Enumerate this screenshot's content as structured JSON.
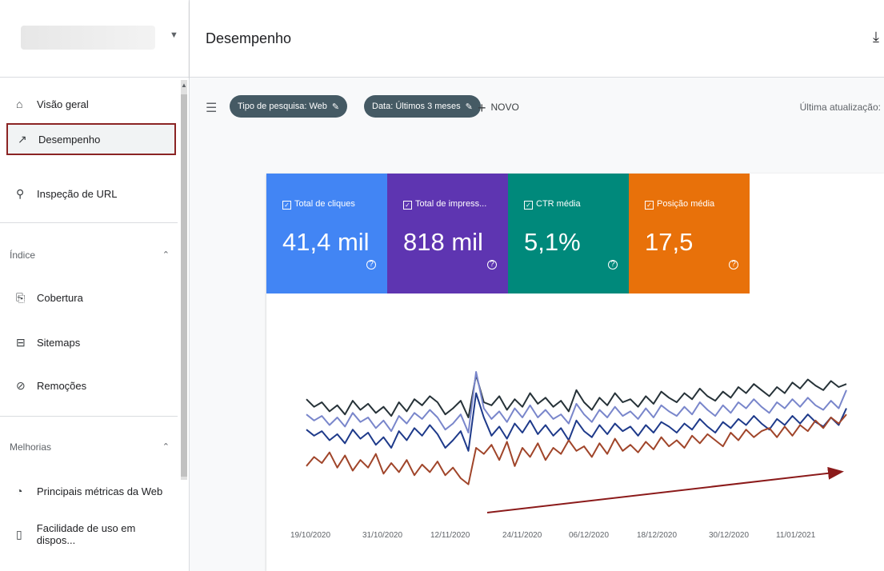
{
  "header": {
    "title": "Desempenho"
  },
  "sidebar": {
    "items": [
      {
        "label": "Visão geral",
        "icon": "home-icon"
      },
      {
        "label": "Desempenho",
        "icon": "trend-icon"
      },
      {
        "label": "Inspeção de URL",
        "icon": "search-icon"
      }
    ],
    "sections": [
      {
        "title": "Índice",
        "items": [
          {
            "label": "Cobertura",
            "icon": "coverage-icon"
          },
          {
            "label": "Sitemaps",
            "icon": "sitemap-icon"
          },
          {
            "label": "Remoções",
            "icon": "removal-icon"
          }
        ]
      },
      {
        "title": "Melhorias",
        "items": [
          {
            "label": "Principais métricas da Web",
            "icon": "gauge-icon"
          },
          {
            "label": "Facilidade de uso em dispos...",
            "icon": "mobile-icon"
          }
        ]
      }
    ]
  },
  "filters": {
    "chips": [
      "Tipo de pesquisa: Web",
      "Data: Últimos 3 meses"
    ],
    "new_label": "NOVO",
    "updated_label": "Última atualização:"
  },
  "metrics": [
    {
      "label": "Total de cliques",
      "value": "41,4 mil",
      "color": "#4285f4"
    },
    {
      "label": "Total de impress...",
      "value": "818 mil",
      "color": "#5e35b1"
    },
    {
      "label": "CTR média",
      "value": "5,1%",
      "color": "#00897b"
    },
    {
      "label": "Posição média",
      "value": "17,5",
      "color": "#e8710a"
    }
  ],
  "chart_data": {
    "type": "line",
    "x_ticks": [
      "19/10/2020",
      "31/10/2020",
      "12/11/2020",
      "24/11/2020",
      "06/12/2020",
      "18/12/2020",
      "30/12/2020",
      "11/01/2021"
    ],
    "series": [
      {
        "name": "Total de impress...",
        "color": "#263238",
        "values": [
          62,
          57,
          60,
          54,
          58,
          52,
          61,
          55,
          59,
          53,
          57,
          51,
          60,
          54,
          62,
          58,
          64,
          60,
          52,
          56,
          61,
          50,
          78,
          60,
          58,
          64,
          55,
          62,
          57,
          66,
          59,
          63,
          57,
          61,
          54,
          68,
          60,
          55,
          63,
          58,
          66,
          60,
          62,
          57,
          64,
          59,
          67,
          63,
          60,
          66,
          62,
          69,
          64,
          61,
          67,
          63,
          70,
          66,
          72,
          68,
          64,
          70,
          66,
          73,
          69,
          75,
          71,
          68,
          74,
          70,
          72
        ]
      },
      {
        "name": "Total de cliques",
        "color": "#7986cb",
        "values": [
          52,
          48,
          51,
          45,
          50,
          44,
          53,
          47,
          50,
          43,
          48,
          41,
          51,
          46,
          53,
          49,
          55,
          50,
          42,
          46,
          52,
          40,
          80,
          56,
          49,
          54,
          47,
          56,
          50,
          58,
          50,
          55,
          49,
          52,
          46,
          59,
          52,
          47,
          55,
          50,
          57,
          51,
          54,
          49,
          56,
          50,
          58,
          54,
          51,
          57,
          52,
          60,
          55,
          51,
          58,
          53,
          60,
          56,
          62,
          57,
          53,
          60,
          56,
          62,
          57,
          63,
          58,
          55,
          61,
          56,
          68
        ]
      },
      {
        "name": "CTR média",
        "color": "#1e3a8a",
        "values": [
          42,
          38,
          41,
          35,
          39,
          33,
          42,
          36,
          40,
          32,
          37,
          30,
          41,
          35,
          43,
          38,
          45,
          39,
          30,
          35,
          41,
          28,
          66,
          50,
          38,
          44,
          36,
          46,
          40,
          48,
          39,
          45,
          38,
          43,
          35,
          48,
          41,
          37,
          45,
          39,
          46,
          41,
          44,
          38,
          45,
          40,
          47,
          44,
          40,
          46,
          42,
          49,
          44,
          40,
          47,
          43,
          49,
          45,
          51,
          46,
          42,
          49,
          45,
          51,
          46,
          52,
          47,
          44,
          50,
          45,
          56
        ]
      },
      {
        "name": "Posição média",
        "color": "#a0452a",
        "values": [
          18,
          24,
          20,
          27,
          17,
          25,
          15,
          22,
          17,
          26,
          13,
          20,
          14,
          22,
          12,
          19,
          14,
          21,
          12,
          17,
          10,
          6,
          30,
          26,
          32,
          22,
          34,
          18,
          30,
          24,
          33,
          22,
          30,
          26,
          35,
          28,
          31,
          24,
          33,
          26,
          36,
          28,
          32,
          27,
          34,
          29,
          37,
          31,
          35,
          30,
          38,
          33,
          39,
          35,
          31,
          40,
          35,
          42,
          37,
          41,
          43,
          37,
          44,
          38,
          45,
          41,
          48,
          43,
          50,
          46,
          52
        ]
      }
    ],
    "annotation": "trend-arrow"
  }
}
